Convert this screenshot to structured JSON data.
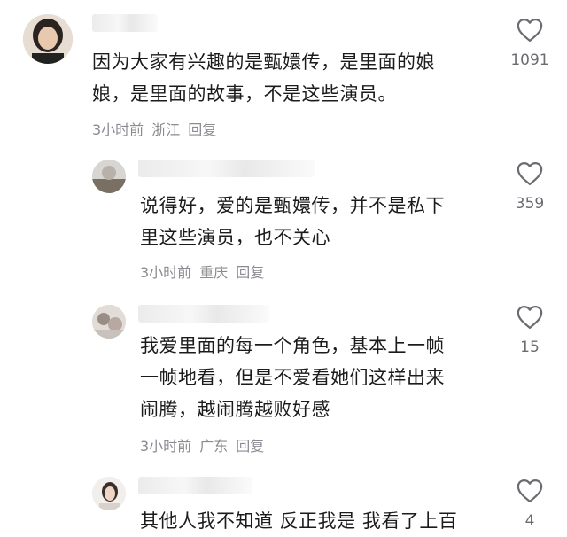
{
  "comments": [
    {
      "text_lines": [
        "因为大家有兴趣的是甄嬛传，是里面的娘",
        "娘，是里面的故事，不是这些演员。"
      ],
      "time": "3小时前",
      "location": "浙江",
      "reply_label": "回复",
      "like_count": "1091",
      "like_icon": "heart-outline-icon"
    },
    {
      "text_lines": [
        "说得好，爱的是甄嬛传，并不是私下",
        "里这些演员，也不关心"
      ],
      "time": "3小时前",
      "location": "重庆",
      "reply_label": "回复",
      "like_count": "359",
      "like_icon": "heart-outline-icon"
    },
    {
      "text_lines": [
        "我爱里面的每一个角色，基本上一帧",
        "一帧地看，但是不爱看她们这样出来",
        "闹腾，越闹腾越败好感"
      ],
      "time": "3小时前",
      "location": "广东",
      "reply_label": "回复",
      "like_count": "15",
      "like_icon": "heart-outline-icon"
    },
    {
      "text_lines": [
        "其他人我不知道 反正我是 我看了上百"
      ],
      "like_count": "4",
      "like_icon": "heart-outline-icon"
    }
  ],
  "colors": {
    "text": "#1b1b1b",
    "meta": "#8a8b91",
    "like_icon": "#6b6c72"
  }
}
